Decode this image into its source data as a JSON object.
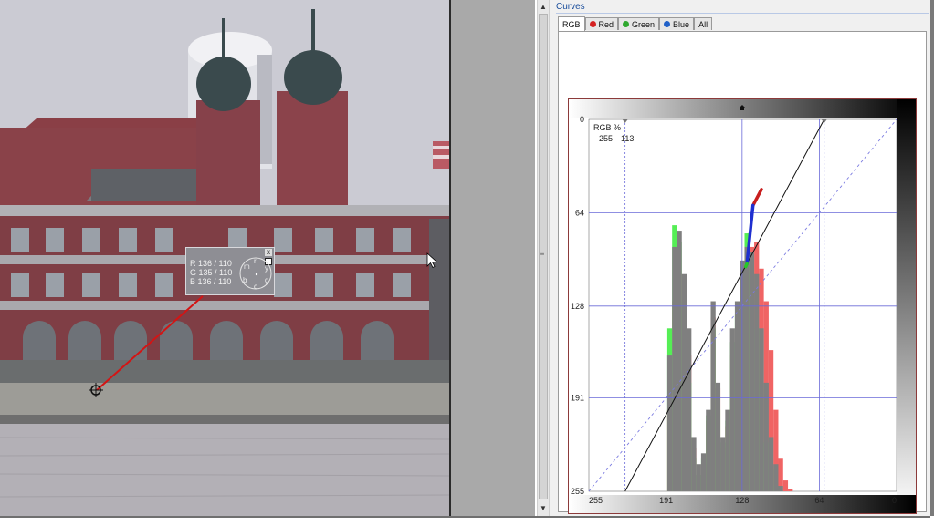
{
  "readout": {
    "rows": [
      "R 136 / 110",
      "G 135 / 110",
      "B 136 / 110"
    ],
    "close_glyph": "x",
    "wheel_letters": [
      "m",
      "r",
      "y",
      "g",
      "c",
      "b"
    ]
  },
  "curves": {
    "title": "Curves",
    "tabs": [
      {
        "label": "RGB",
        "active": true,
        "dot": null
      },
      {
        "label": "Red",
        "active": false,
        "dot": "#d42020"
      },
      {
        "label": "Green",
        "active": false,
        "dot": "#2ea82e"
      },
      {
        "label": "Blue",
        "active": false,
        "dot": "#2060c8"
      },
      {
        "label": "All",
        "active": false,
        "dot": null
      }
    ],
    "info_label": "RGB %",
    "info_in": "255",
    "info_out": "113"
  },
  "chart_data": {
    "type": "area",
    "x_tick_labels": [
      "255",
      "191",
      "128",
      "64",
      "0"
    ],
    "y_tick_labels": [
      "0",
      "64",
      "128",
      "191",
      "255"
    ],
    "x_ticks": [
      255,
      191,
      128,
      64,
      0
    ],
    "y_ticks": [
      0,
      64,
      128,
      191,
      255
    ],
    "xlim": [
      255,
      0
    ],
    "ylim": [
      0,
      255
    ],
    "grid": true,
    "curve_points": [
      [
        225,
        255
      ],
      [
        60,
        0
      ]
    ],
    "diagonal": [
      [
        255,
        255
      ],
      [
        0,
        0
      ]
    ],
    "selection_segments": [
      {
        "color": "#c81e1e",
        "from": [
          112,
          48
        ],
        "to": [
          119,
          59
        ]
      },
      {
        "color": "#1e2fd0",
        "from": [
          119,
          59
        ],
        "to": [
          124,
          99
        ]
      },
      {
        "color": "#26c826",
        "from": [
          124,
          99
        ],
        "to": [
          125,
          101
        ]
      }
    ],
    "histogram": {
      "bins": [
        200,
        196,
        192,
        188,
        184,
        180,
        176,
        172,
        168,
        164,
        160,
        156,
        152,
        148,
        144,
        140,
        136,
        132,
        128,
        124,
        120,
        116,
        112,
        108,
        104,
        100,
        96,
        92,
        88,
        84,
        80,
        76
      ],
      "gray": [
        0,
        0,
        0,
        50,
        90,
        96,
        80,
        60,
        20,
        10,
        14,
        30,
        70,
        40,
        20,
        30,
        60,
        70,
        85,
        90,
        88,
        80,
        60,
        40,
        20,
        10,
        2,
        0,
        0,
        0,
        0,
        0
      ],
      "green": [
        0,
        0,
        0,
        60,
        98,
        92,
        70,
        40,
        12,
        6,
        12,
        28,
        60,
        30,
        18,
        26,
        55,
        65,
        80,
        95,
        82,
        60,
        40,
        18,
        8,
        2,
        0,
        0,
        0,
        0,
        0,
        0
      ],
      "red": [
        0,
        0,
        0,
        30,
        70,
        80,
        70,
        50,
        16,
        6,
        10,
        26,
        64,
        38,
        16,
        24,
        50,
        60,
        72,
        82,
        90,
        92,
        82,
        70,
        52,
        30,
        12,
        4,
        1,
        0,
        0,
        0
      ]
    }
  }
}
